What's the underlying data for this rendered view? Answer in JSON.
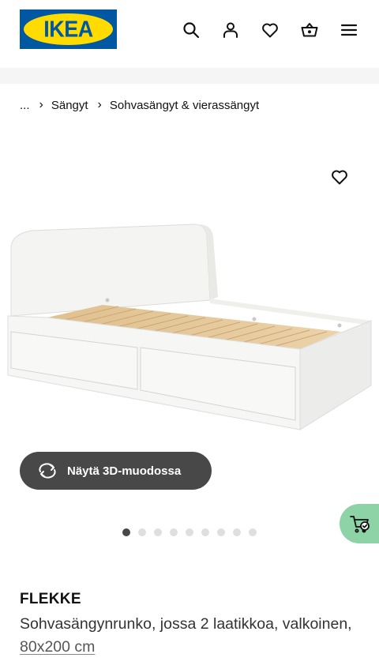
{
  "header": {
    "logo_text": "IKEA",
    "icons": [
      "search-icon",
      "account-icon",
      "favourites-icon",
      "shopping-bag-icon",
      "menu-icon"
    ]
  },
  "breadcrumb": {
    "items": [
      "...",
      "Sängyt",
      "Sohvasängyt & vierassängyt"
    ],
    "separator": "›"
  },
  "gallery": {
    "view_3d_label": "Näytä 3D-muodossa",
    "total_images": 9,
    "active_index": 1
  },
  "product": {
    "name": "FLEKKE",
    "description": "Sohvasängynrunko, jossa 2 laatikkoa, valkoinen, ",
    "size": "80x200 cm"
  },
  "colors": {
    "ikea_blue": "#0058a3",
    "ikea_yellow": "#ffdb00",
    "button_dark": "#484848",
    "cart_green": "#8dd3a6"
  }
}
